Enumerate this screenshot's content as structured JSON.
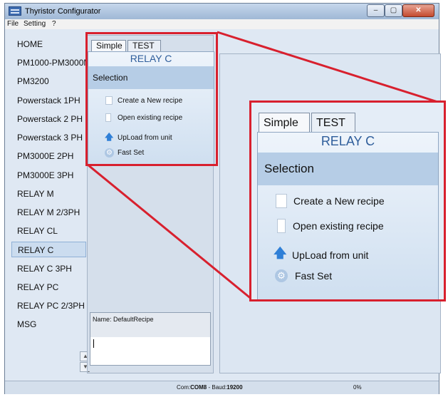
{
  "window": {
    "title": "Thyristor Configurator",
    "min_glyph": "–",
    "max_glyph": "▢",
    "close_glyph": "✕"
  },
  "menu": {
    "file": "File",
    "setting": "Setting",
    "help": "?"
  },
  "sidebar": {
    "items": [
      {
        "label": "HOME"
      },
      {
        "label": "PM1000-PM3000M"
      },
      {
        "label": "PM3200"
      },
      {
        "label": "Powerstack 1PH"
      },
      {
        "label": "Powerstack 2 PH"
      },
      {
        "label": "Powerstack 3 PH"
      },
      {
        "label": "PM3000E  2PH"
      },
      {
        "label": "PM3000E  3PH"
      },
      {
        "label": "RELAY M"
      },
      {
        "label": "RELAY M 2/3PH"
      },
      {
        "label": "RELAY CL"
      },
      {
        "label": "RELAY C"
      },
      {
        "label": "RELAY C 3PH"
      },
      {
        "label": "RELAY PC"
      },
      {
        "label": "RELAY PC 2/3PH"
      },
      {
        "label": "MSG"
      }
    ],
    "selected": "RELAY C",
    "scroll_up": "▲",
    "scroll_down": "▼"
  },
  "tabs": {
    "simple": "Simple",
    "test": "TEST"
  },
  "panel": {
    "title": "RELAY C",
    "section": "Selection",
    "items": {
      "create": "Create a New recipe",
      "open": "Open existing recipe",
      "upload": "UpLoad from unit",
      "fastset": "Fast Set"
    },
    "upload_arrow": "🡅",
    "fastset_glyph": "⚙"
  },
  "zoom": {
    "tabs": {
      "simple": "Simple",
      "test": "TEST"
    },
    "title": "RELAY C",
    "section": "Selection",
    "items": {
      "create": "Create a New recipe",
      "open": "Open existing recipe",
      "upload": "UpLoad from unit",
      "fastset": "Fast Set"
    },
    "upload_arrow": "🡅",
    "fastset_glyph": "⚙"
  },
  "recipe": {
    "name_line": "Name: DefaultRecipe",
    "dash": "-"
  },
  "status": {
    "com_prefix": "Com:",
    "com_port": "COM8",
    "baud_prefix": " - Baud:",
    "baud": "19200",
    "progress": "0%"
  },
  "colors": {
    "highlight": "#d8202e",
    "panel_title": "#2f5e9b",
    "upload_arrow": "#2f7fd7"
  }
}
